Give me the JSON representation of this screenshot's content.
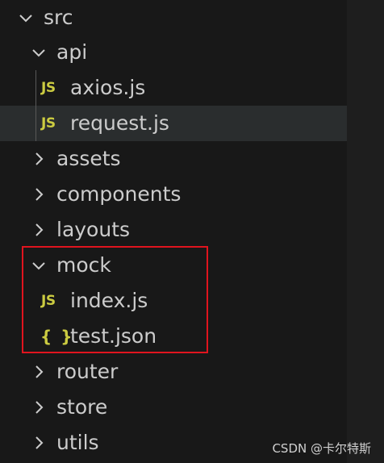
{
  "explorer": {
    "tree": [
      {
        "label": "src",
        "type": "folder",
        "expanded": true,
        "chevron_icon": "chevron-down-icon"
      },
      {
        "label": "api",
        "type": "folder",
        "expanded": true,
        "chevron_icon": "chevron-down-icon"
      },
      {
        "label": "axios.js",
        "type": "file",
        "file_icon": "js-file-icon",
        "icon_text": "JS"
      },
      {
        "label": "request.js",
        "type": "file",
        "file_icon": "js-file-icon",
        "icon_text": "JS",
        "selected": true
      },
      {
        "label": "assets",
        "type": "folder",
        "expanded": false,
        "chevron_icon": "chevron-right-icon"
      },
      {
        "label": "components",
        "type": "folder",
        "expanded": false,
        "chevron_icon": "chevron-right-icon"
      },
      {
        "label": "layouts",
        "type": "folder",
        "expanded": false,
        "chevron_icon": "chevron-right-icon"
      },
      {
        "label": "mock",
        "type": "folder",
        "expanded": true,
        "chevron_icon": "chevron-down-icon"
      },
      {
        "label": "index.js",
        "type": "file",
        "file_icon": "js-file-icon",
        "icon_text": "JS"
      },
      {
        "label": "test.json",
        "type": "file",
        "file_icon": "json-file-icon",
        "icon_text": "{ }"
      },
      {
        "label": "router",
        "type": "folder",
        "expanded": false,
        "chevron_icon": "chevron-right-icon"
      },
      {
        "label": "store",
        "type": "folder",
        "expanded": false,
        "chevron_icon": "chevron-right-icon"
      },
      {
        "label": "utils",
        "type": "folder",
        "expanded": false,
        "chevron_icon": "chevron-right-icon"
      }
    ]
  },
  "colors": {
    "text": "#cccccc",
    "js_icon": "#cbcb41",
    "highlight_border": "#e0141e",
    "selected_row": "#2a2d2e",
    "background": "#181818"
  },
  "watermark": "CSDN @卡尔特斯"
}
